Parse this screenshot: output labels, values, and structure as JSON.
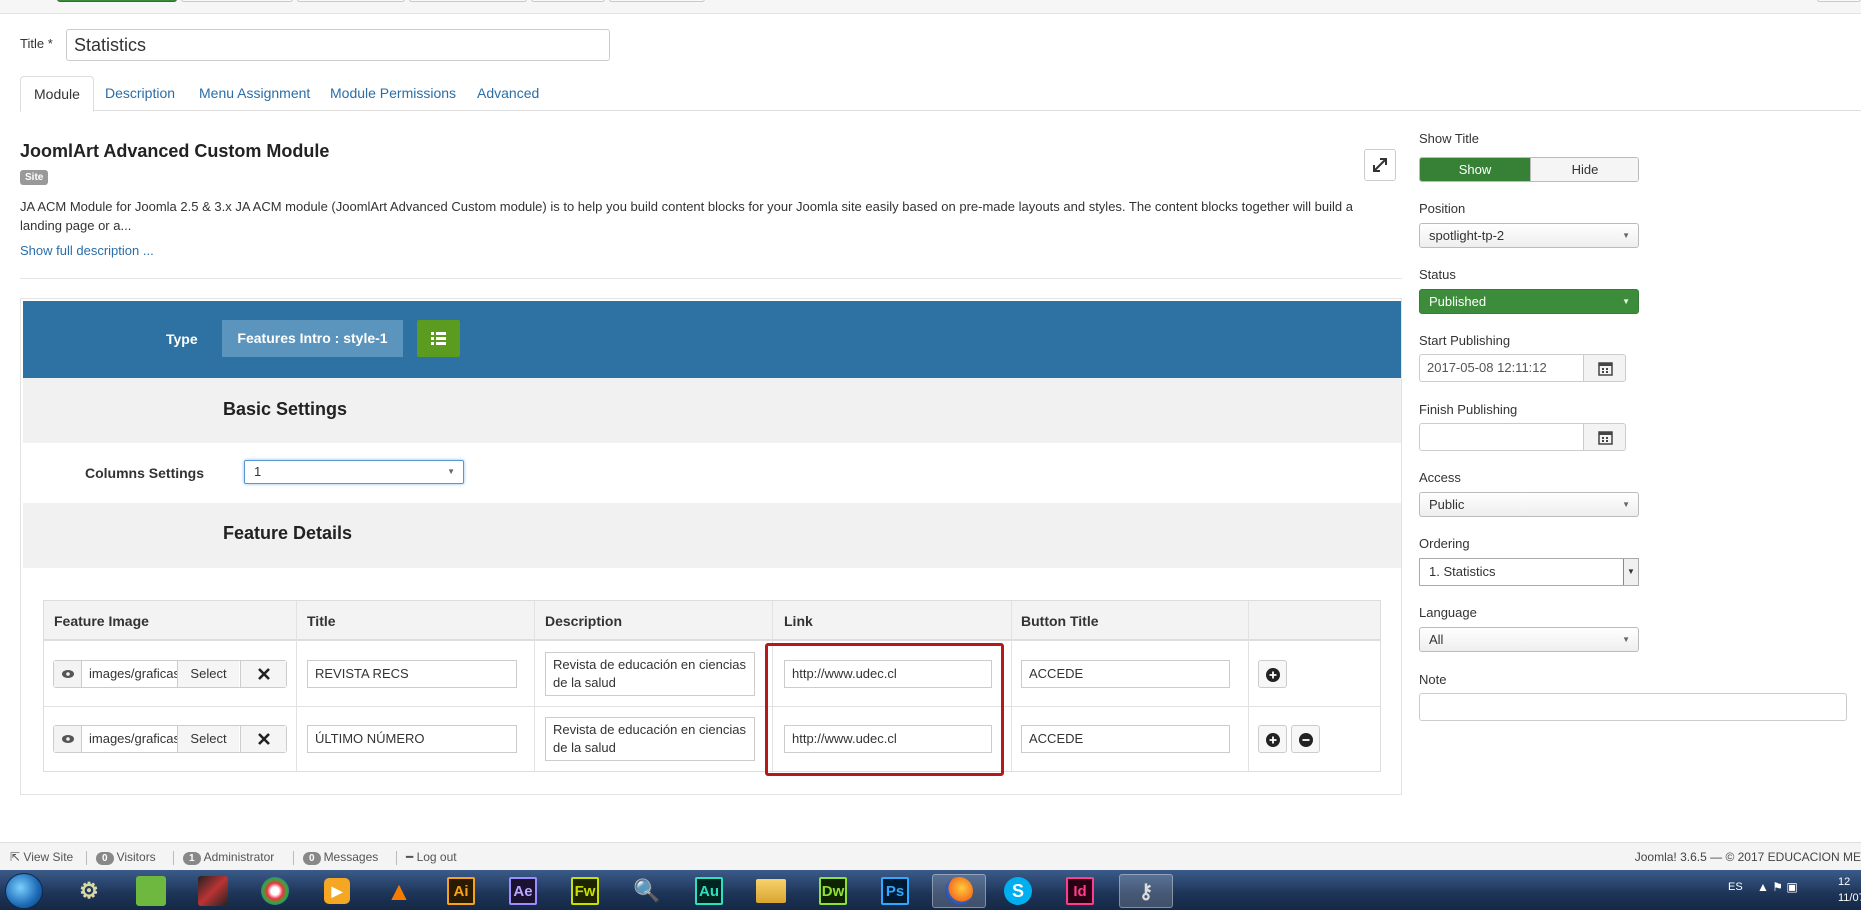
{
  "title_field": {
    "label": "Title *",
    "value": "Statistics"
  },
  "tabs": [
    {
      "label": "Module",
      "active": true
    },
    {
      "label": "Description"
    },
    {
      "label": "Menu Assignment"
    },
    {
      "label": "Module Permissions"
    },
    {
      "label": "Advanced"
    }
  ],
  "module": {
    "heading": "JoomlArt Advanced Custom Module",
    "badge": "Site",
    "description": "JA ACM Module for Joomla 2.5 & 3.x JA ACM module (JoomlArt Advanced Custom module) is to help you build content blocks for your Joomla site easily based on pre-made layouts and styles. The content blocks together will build a landing page or a...",
    "show_full": "Show full description ..."
  },
  "acm": {
    "type_label": "Type",
    "type_value": "Features Intro : style-1",
    "basic_settings": "Basic Settings",
    "columns_label": "Columns Settings",
    "columns_value": "1",
    "feature_details": "Feature Details",
    "table": {
      "headers": [
        "Feature Image",
        "Title",
        "Description",
        "Link",
        "Button Title"
      ],
      "rows": [
        {
          "image": "images/graficas",
          "select": "Select",
          "title": "REVISTA RECS",
          "description": "Revista de educación en ciencias de la salud",
          "link": "http://www.udec.cl",
          "button_title": "ACCEDE"
        },
        {
          "image": "images/graficas",
          "select": "Select",
          "title": "ÚLTIMO NÚMERO",
          "description": "Revista de educación en ciencias de la salud",
          "link": "http://www.udec.cl",
          "button_title": "ACCEDE"
        }
      ]
    }
  },
  "sidebar": {
    "show_title": {
      "label": "Show Title",
      "show": "Show",
      "hide": "Hide"
    },
    "position": {
      "label": "Position",
      "value": "spotlight-tp-2"
    },
    "status": {
      "label": "Status",
      "value": "Published"
    },
    "start_publishing": {
      "label": "Start Publishing",
      "value": "2017-05-08 12:11:12"
    },
    "finish_publishing": {
      "label": "Finish Publishing",
      "value": ""
    },
    "access": {
      "label": "Access",
      "value": "Public"
    },
    "ordering": {
      "label": "Ordering",
      "value": "1. Statistics"
    },
    "language": {
      "label": "Language",
      "value": "All"
    },
    "note": {
      "label": "Note",
      "value": ""
    }
  },
  "statusbar": {
    "view_site": "View Site",
    "visitors_count": "0",
    "visitors": "Visitors",
    "admin_count": "1",
    "admin": "Administrator",
    "messages_count": "0",
    "messages": "Messages",
    "logout": "Log out",
    "right": "Joomla! 3.6.5 — © 2017 EDUCACION ME"
  },
  "taskbar": {
    "apps": [
      {
        "name": "illustrator",
        "text": "Ai"
      },
      {
        "name": "after-effects",
        "text": "Ae"
      },
      {
        "name": "fireworks",
        "text": "Fw"
      },
      {
        "name": "audition",
        "text": "Au"
      },
      {
        "name": "dreamweaver",
        "text": "Dw"
      },
      {
        "name": "photoshop",
        "text": "Ps"
      },
      {
        "name": "indesign",
        "text": "Id"
      }
    ],
    "lang": "ES",
    "time": "12",
    "date": "11/07"
  },
  "colors": {
    "primary_blue": "#2d72a3",
    "green": "#378137",
    "highlight_red": "#b51a1a",
    "link": "#2a6da7"
  }
}
